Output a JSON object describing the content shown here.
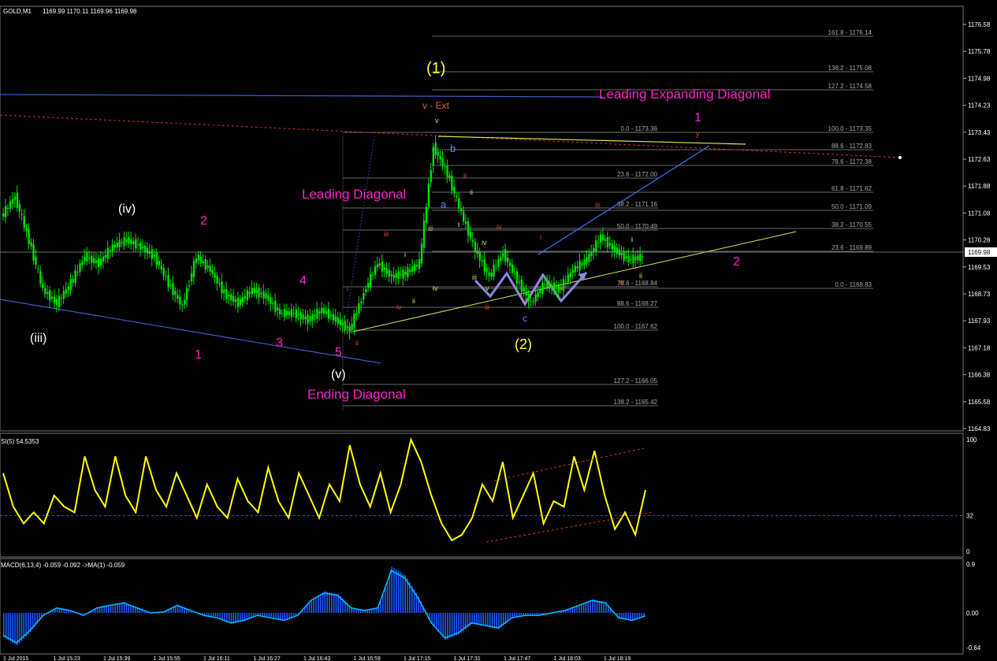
{
  "header": {
    "symbol": "GOLD,M1",
    "ohlc": "1169.99 1170.11 1169.96 1169.98"
  },
  "colors": {
    "background": "#000000",
    "candle": "#00e000",
    "rsi_line": "#ffff00",
    "macd_hist": "#1e5bff",
    "macd_signal": "#00bfff",
    "magenta": "#ff22cc",
    "yellow": "#ffff00",
    "white_label": "#ffffff",
    "fib_line": "#8a8a8a",
    "blue_line": "#3a5ccc",
    "red_dash": "#d03030",
    "channel_yellow": "#d7e84a",
    "purple_arrow": "#8a8ae0"
  },
  "annotations": {
    "wave1_big": "(1)",
    "wave2_big": "(2)",
    "v_ext": "v - Ext",
    "leading_expanding_diagonal": "Leading Expanding Diagonal",
    "leading_diagonal": "Leading Diagonal",
    "ending_diagonal": "Ending Diagonal",
    "wave_iii_white": "(iii)",
    "wave_iv_white": "(iv)",
    "wave_v_white": "(v)",
    "m1": "1",
    "m2": "2",
    "m3": "3",
    "m4": "4",
    "m5": "5",
    "m1_right": "1",
    "m2_right": "2",
    "sub_a": "a",
    "sub_b": "b",
    "sub_c": "c",
    "roman_i": "i",
    "roman_ii": "ii",
    "roman_iii": "iii",
    "roman_iv": "iv",
    "roman_v": "v",
    "roman_y": "y"
  },
  "fib_levels": [
    {
      "label": "161.8 - 1176.14"
    },
    {
      "label": "138.2 - 1175.08"
    },
    {
      "label": "127.2 - 1174.58"
    },
    {
      "label": "100.0 - 1173.35"
    },
    {
      "label": "88.6 - 1172.83"
    },
    {
      "label": "78.6 - 1172.38"
    },
    {
      "label": "61.8 - 1171.62"
    },
    {
      "label": "50.0 - 1171.09"
    },
    {
      "label": "38.2 - 1170.55"
    },
    {
      "label": "23.6 - 1169.89"
    },
    {
      "label": "0.0 - 1168.83"
    },
    {
      "label": "0.0 - 1173.36"
    },
    {
      "label": "23.6 - 1172.00"
    },
    {
      "label": "38.2 - 1171.16"
    },
    {
      "label": "50.0 - 1170.49"
    },
    {
      "label": "78.6 - 1168.84"
    },
    {
      "label": "88.6 - 1168.27"
    },
    {
      "label": "100.0 - 1167.62"
    },
    {
      "label": "127.2 - 1166.05"
    },
    {
      "label": "138.2 - 1165.42"
    }
  ],
  "chart_data": [
    {
      "type": "candlestick",
      "title": "GOLD,M1",
      "y_axis_ticks": [
        "1176.58",
        "1175.78",
        "1174.98",
        "1174.23",
        "1173.43",
        "1172.63",
        "1171.88",
        "1171.08",
        "1170.28",
        "1169.53",
        "1168.73",
        "1167.93",
        "1167.18",
        "1166.38",
        "1165.58",
        "1164.83"
      ],
      "current_price": "1169.98",
      "ylim": [
        1164.83,
        1177.0
      ],
      "x_ticks": [
        "1 Jul 2015",
        "1 Jul 15:23",
        "1 Jul 15:39",
        "1 Jul 15:55",
        "1 Jul 16:11",
        "1 Jul 16:27",
        "1 Jul 16:43",
        "1 Jul 16:59",
        "1 Jul 17:15",
        "1 Jul 17:31",
        "1 Jul 17:47",
        "1 Jul 18:03",
        "1 Jul 18:19"
      ],
      "close_path": [
        1171.2,
        1171.8,
        1170.5,
        1169.0,
        1168.6,
        1169.2,
        1170.0,
        1169.8,
        1170.3,
        1170.5,
        1170.3,
        1170.0,
        1169.2,
        1168.5,
        1170.0,
        1169.6,
        1168.9,
        1168.6,
        1169.0,
        1168.8,
        1168.3,
        1168.3,
        1168.1,
        1168.4,
        1168.1,
        1167.8,
        1168.9,
        1169.8,
        1169.4,
        1169.5,
        1169.8,
        1173.3,
        1172.5,
        1171.3,
        1170.2,
        1169.4,
        1170.1,
        1169.3,
        1168.6,
        1169.2,
        1169.0,
        1169.6,
        1169.9,
        1170.6,
        1170.2,
        1169.9,
        1170.0
      ]
    },
    {
      "type": "line",
      "title": "SI(5) 54.5353",
      "y_axis_ticks": [
        "100",
        "32",
        "0"
      ],
      "ylim": [
        0,
        100
      ],
      "level": 32,
      "values": [
        70,
        40,
        25,
        35,
        25,
        50,
        40,
        35,
        85,
        55,
        40,
        85,
        50,
        35,
        85,
        55,
        40,
        70,
        50,
        30,
        60,
        40,
        30,
        65,
        45,
        35,
        75,
        45,
        30,
        70,
        50,
        30,
        60,
        45,
        95,
        60,
        40,
        70,
        35,
        60,
        100,
        80,
        50,
        25,
        10,
        15,
        30,
        60,
        45,
        80,
        30,
        50,
        70,
        25,
        45,
        40,
        85,
        55,
        90,
        50,
        20,
        35,
        15,
        55
      ]
    },
    {
      "type": "bar",
      "title": "MACD(6,13,4) -0.059 -0.092 ->MA(1) -0.059",
      "y_axis_ticks": [
        "0.9",
        "0.00",
        "-0.64"
      ],
      "ylim": [
        -0.64,
        0.9
      ],
      "values": [
        -0.45,
        -0.6,
        -0.35,
        -0.05,
        0.1,
        0.05,
        -0.05,
        0.1,
        0.15,
        0.2,
        0.1,
        0.0,
        0.02,
        0.15,
        0.05,
        -0.05,
        -0.1,
        -0.2,
        -0.15,
        -0.05,
        -0.1,
        -0.15,
        -0.05,
        0.25,
        0.4,
        0.35,
        0.1,
        0.05,
        0.1,
        0.85,
        0.7,
        0.3,
        -0.2,
        -0.5,
        -0.4,
        -0.2,
        -0.25,
        -0.3,
        -0.1,
        -0.05,
        -0.05,
        0.0,
        0.05,
        0.15,
        0.25,
        0.2,
        -0.1,
        -0.15,
        -0.06
      ]
    }
  ]
}
